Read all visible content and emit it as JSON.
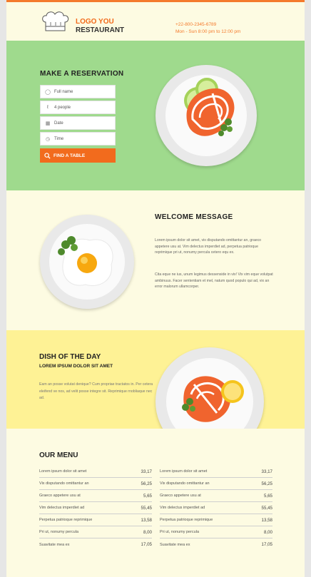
{
  "header": {
    "logo_line1": "LOGO YOU",
    "logo_line2": "RESTAURANT",
    "phone": "+22-800-2345-6789",
    "hours": "Mon - Sun 8:00 pm to 12:00 pm"
  },
  "reservation": {
    "title": "MAKE A RESERVATION",
    "fields": [
      {
        "icon": "user-icon",
        "placeholder": "Full name"
      },
      {
        "icon": "people-icon",
        "placeholder": "4 people"
      },
      {
        "icon": "calendar-icon",
        "placeholder": "Date"
      },
      {
        "icon": "clock-icon",
        "placeholder": "Time"
      }
    ],
    "button_label": "FIND A TABLE"
  },
  "welcome": {
    "title": "WELCOME  MESSAGE",
    "paragraph1": "Lorem ipsum dolor sit amet, vix disputando omittantur an, graeco appetere usu at. Vim delectus imperdiet ad, perpetua patrioque reprimique pri ut, nonumy percula cetero equ ex.",
    "paragraph2": "Cita eque ne ius, unum legimus dessenside in vix! Vix vim eque volutpat ambinuus. Facer sententiam et mel, natum quod populo qui ad, vix an error malorum ullamcorper."
  },
  "dish": {
    "title": "DISH OF THE DAY",
    "subtitle": "LOREM IPSUM DOLOR SIT AMET",
    "paragraph": "Eam an posse volutat denique? Cum propriae tractatos in. Per cetera eleifend ve nos, ad velit posse integre sit. Reprimique rnobliaque nec ad."
  },
  "menu": {
    "title": "OUR MENU",
    "left": [
      {
        "name": "Lorem ipsum dolor sit amet",
        "price": "33,17"
      },
      {
        "name": "Vix disputando omittantur an",
        "price": "56,25"
      },
      {
        "name": "Graeco appetere usu at",
        "price": "5,65"
      },
      {
        "name": "Vim delectus imperdiet ad",
        "price": "55,45"
      },
      {
        "name": "Perpetua patrioque reprimique",
        "price": "13,58"
      },
      {
        "name": "Pri ut, nonumy percula",
        "price": "8,00"
      },
      {
        "name": "Suavitate mea ex",
        "price": "17,05"
      }
    ],
    "right": [
      {
        "name": "Lorem ipsum dolor sit amet",
        "price": "33,17"
      },
      {
        "name": "Vix disputando omittantur an",
        "price": "56,25"
      },
      {
        "name": "Graeco appetere usu at",
        "price": "5,65"
      },
      {
        "name": "Vim delectus imperdiet ad",
        "price": "55,45"
      },
      {
        "name": "Perpetua patrioque reprimique",
        "price": "13,58"
      },
      {
        "name": "Pri ut, nonumy percula",
        "price": "8,00"
      },
      {
        "name": "Suavitate mea ex",
        "price": "17,05"
      }
    ]
  },
  "colors": {
    "accent": "#f26b1d",
    "green": "#9fda8d",
    "cream": "#fdfbe2",
    "yellow": "#fef295"
  }
}
